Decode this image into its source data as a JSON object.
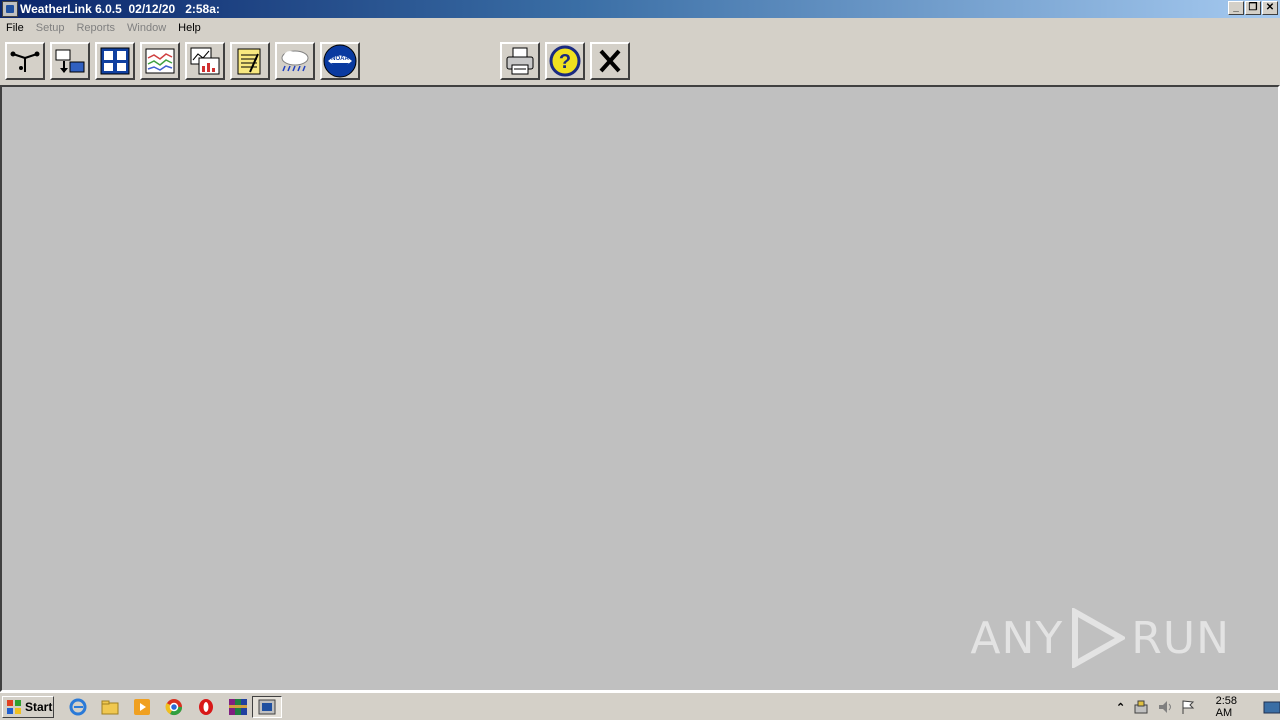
{
  "window": {
    "title": "WeatherLink 6.0.5  02/12/20   2:58a:",
    "controls": {
      "minimize": "_",
      "restore": "❐",
      "close": "✕"
    }
  },
  "menu": {
    "items": [
      {
        "label": "File",
        "enabled": true
      },
      {
        "label": "Setup",
        "enabled": false
      },
      {
        "label": "Reports",
        "enabled": false
      },
      {
        "label": "Window",
        "enabled": false
      },
      {
        "label": "Help",
        "enabled": true
      }
    ]
  },
  "toolbar": {
    "buttons": [
      {
        "name": "anemometer-icon"
      },
      {
        "name": "station-transfer-icon"
      },
      {
        "name": "bulletin-icon"
      },
      {
        "name": "plot-icon"
      },
      {
        "name": "strip-chart-icon"
      },
      {
        "name": "notepad-icon"
      },
      {
        "name": "rain-cloud-icon"
      },
      {
        "name": "noaa-icon"
      },
      {
        "name": "printer-icon"
      },
      {
        "name": "help-icon"
      },
      {
        "name": "close-icon"
      }
    ],
    "noaa_text": "NOAA"
  },
  "watermark": {
    "text_left": "ANY",
    "text_right": "RUN"
  },
  "taskbar": {
    "start_label": "Start",
    "clock": "2:58 AM",
    "quick_launch": [
      "ie-icon",
      "explorer-icon",
      "media-player-icon",
      "chrome-icon",
      "opera-icon",
      "winrar-icon"
    ],
    "active_task": "weatherlink-task"
  },
  "colors": {
    "title_gradient_start": "#0a246a",
    "title_gradient_end": "#a6caf0",
    "workspace": "#c0c0c0",
    "chrome": "#d4d0c8"
  }
}
